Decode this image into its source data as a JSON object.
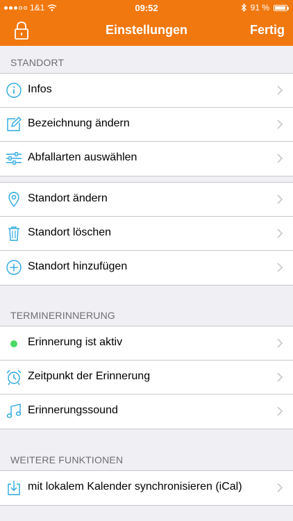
{
  "status_bar": {
    "carrier": "1&1",
    "time": "09:52",
    "battery": "91 %",
    "battery_level": 0.91
  },
  "nav": {
    "title": "Einstellungen",
    "done": "Fertig",
    "left_icon": "lock-icon"
  },
  "sections": {
    "standort": "STANDORT",
    "termin": "TERMINERINNERUNG",
    "weitere": "WEITERE FUNKTIONEN"
  },
  "groups": {
    "standort1": [
      {
        "label": "Infos",
        "icon": "info-icon"
      },
      {
        "label": "Bezeichnung ändern",
        "icon": "edit-icon"
      },
      {
        "label": "Abfallarten auswählen",
        "icon": "sliders-icon"
      }
    ],
    "standort2": [
      {
        "label": "Standort ändern",
        "icon": "location-pin-icon"
      },
      {
        "label": "Standort löschen",
        "icon": "trash-icon"
      },
      {
        "label": "Standort hinzufügen",
        "icon": "add-circle-icon"
      }
    ],
    "termin": [
      {
        "label": "Erinnerung ist aktiv",
        "icon": "status-dot"
      },
      {
        "label": "Zeitpunkt der Erinnerung",
        "icon": "alarm-clock-icon"
      },
      {
        "label": "Erinnerungssound",
        "icon": "music-note-icon"
      }
    ],
    "weitere": [
      {
        "label": "mit lokalem Kalender synchronisieren (iCal)",
        "icon": "download-icon"
      }
    ]
  },
  "colors": {
    "accent": "#f1780f",
    "icon": "#2aa8e0",
    "active": "#4cd964"
  }
}
